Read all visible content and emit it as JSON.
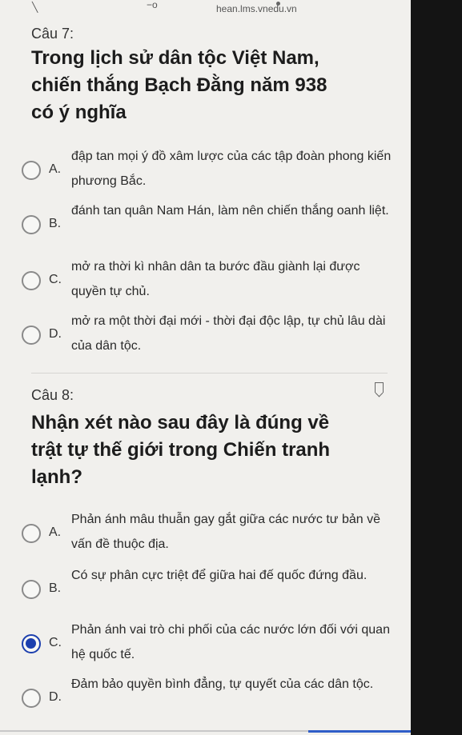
{
  "browser": {
    "url": "hean.lms.vnedu.vn"
  },
  "questions": [
    {
      "label": "Câu 7:",
      "text": "Trong lịch sử dân tộc Việt Nam, chiến thắng Bạch Đằng năm 938 có ý nghĩa",
      "options": [
        {
          "letter": "A.",
          "text": "đập tan mọi ý đồ xâm lược của các tập đoàn phong kiến phương Bắc."
        },
        {
          "letter": "B.",
          "text": "đánh tan quân Nam Hán, làm nên chiến thắng oanh liệt."
        },
        {
          "letter": "C.",
          "text": "mở ra thời kì nhân dân ta bước đầu giành lại được quyền tự chủ."
        },
        {
          "letter": "D.",
          "text": "mở ra một thời đại mới - thời đại độc lập, tự chủ lâu dài của dân tộc."
        }
      ]
    },
    {
      "label": "Câu 8:",
      "text": "Nhận xét nào sau đây là đúng về trật tự thế giới trong Chiến tranh lạnh?",
      "selected_option": "C.",
      "options": [
        {
          "letter": "A.",
          "text": "Phản ánh mâu thuẫn gay gắt giữa các nước tư bản về vấn đề thuộc địa."
        },
        {
          "letter": "B.",
          "text": "Có sự phân cực triệt để giữa hai đế quốc đứng đầu."
        },
        {
          "letter": "C.",
          "text": "Phản ánh vai trò chi phối của các nước lớn đối với quan hệ quốc tế."
        },
        {
          "letter": "D.",
          "text": "Đảm bảo quyền bình đẳng, tự quyết của các dân tộc."
        }
      ]
    }
  ],
  "colors": {
    "selected_radio": "#1c3fae",
    "page_background": "#f1f0ed"
  }
}
